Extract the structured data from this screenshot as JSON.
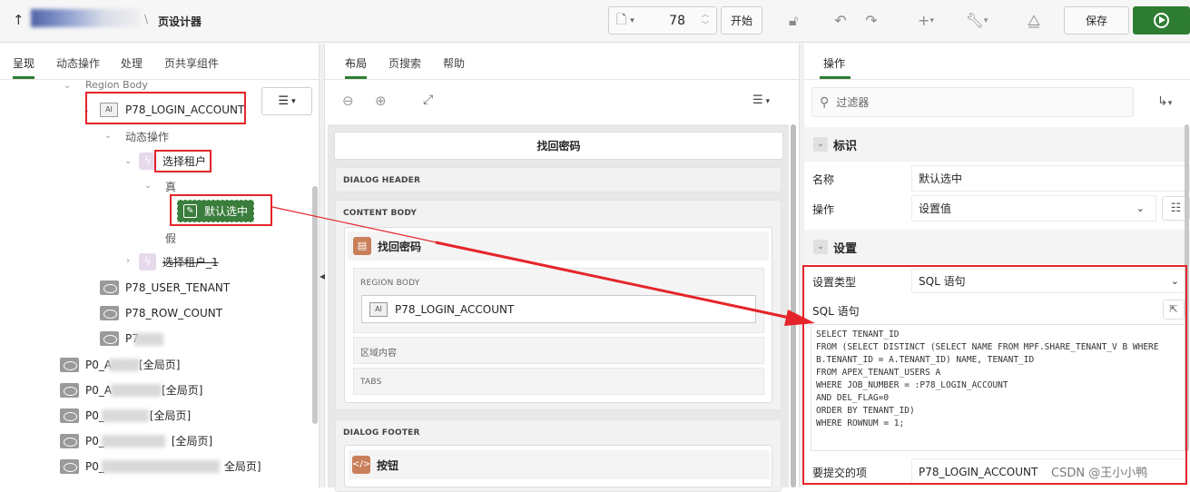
{
  "topbar": {
    "title": "页设计器",
    "page_number": "78",
    "start_label": "开始",
    "save_label": "保存"
  },
  "left": {
    "tabs": [
      "呈现",
      "动态操作",
      "处理",
      "页共享组件"
    ],
    "region_body": "Region Body",
    "login_item": "P78_LOGIN_ACCOUNT",
    "dynamic_actions": "动态操作",
    "select_tenant": "选择租户",
    "true_label": "真",
    "default_select": "默认选中",
    "false_label": "假",
    "select_tenant_1": "选择租户_1",
    "user_tenant": "P78_USER_TENANT",
    "row_count": "P78_ROW_COUNT",
    "p7_partial": "P7",
    "global_items": [
      "P0_A",
      "P0_A",
      "P0_",
      "P0_",
      "P0_"
    ],
    "global_suffixes": [
      "[全局页]",
      "[全局页]",
      "[全局页]",
      "[全局页]",
      "全局页]"
    ]
  },
  "middle": {
    "tabs": [
      "布局",
      "页搜索",
      "帮助"
    ],
    "header_title": "找回密码",
    "dialog_header": "DIALOG HEADER",
    "content_body": "CONTENT BODY",
    "region_title": "找回密码",
    "region_body": "REGION BODY",
    "login_item": "P78_LOGIN_ACCOUNT",
    "region_content": "区域内容",
    "tabs_label": "TABS",
    "dialog_footer": "DIALOG FOOTER",
    "buttons_label": "按钮"
  },
  "right": {
    "tab": "操作",
    "filter_placeholder": "过滤器",
    "identification_title": "标识",
    "name_label": "名称",
    "name_value": "默认选中",
    "action_label": "操作",
    "action_value": "设置值",
    "settings_title": "设置",
    "set_type_label": "设置类型",
    "set_type_value": "SQL 语句",
    "sql_label": "SQL 语句",
    "sql_lines": [
      "SELECT TENANT_ID",
      "FROM (SELECT DISTINCT (SELECT NAME FROM MPF.SHARE_TENANT_V B WHERE",
      "B.TENANT_ID = A.TENANT_ID) NAME, TENANT_ID",
      "FROM APEX_TENANT_USERS A",
      "WHERE JOB_NUMBER = :P78_LOGIN_ACCOUNT",
      "AND DEL_FLAG=0",
      "ORDER BY TENANT_ID)",
      "WHERE ROWNUM = 1;"
    ],
    "submit_label": "要提交的项",
    "submit_value": "P78_LOGIN_ACCOUNT"
  },
  "watermark": "CSDN @王小小鸭"
}
